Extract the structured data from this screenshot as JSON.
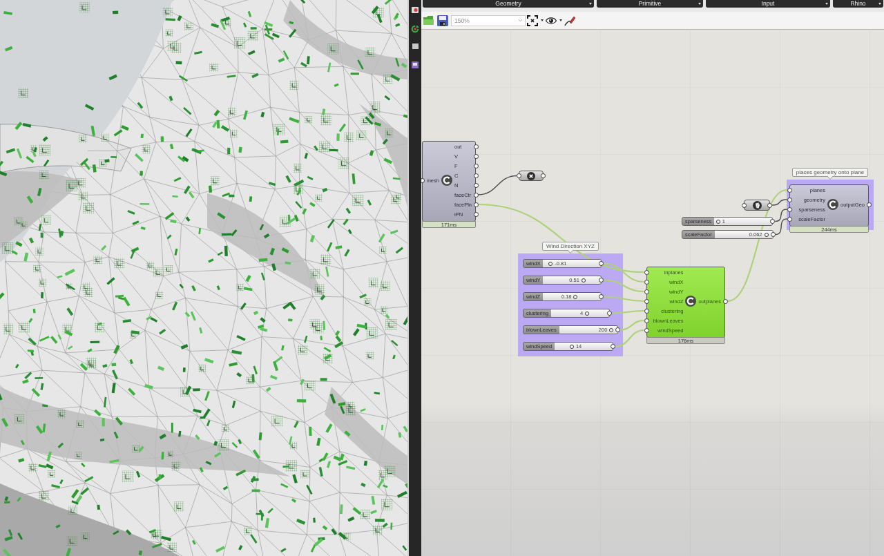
{
  "ribbon": {
    "tabs": [
      {
        "label": "Geometry"
      },
      {
        "label": "Primitive"
      },
      {
        "label": "Input"
      },
      {
        "label": "Rhino"
      }
    ]
  },
  "toolbar": {
    "zoom": "150%"
  },
  "canvas": {
    "components": [
      {
        "inputs": [
          "mesh"
        ],
        "outputs": [
          "out",
          "V",
          "F",
          "C",
          "N",
          "faceCtr",
          "facePln",
          "iPN"
        ],
        "time": "171ms",
        "selected": false
      },
      {
        "inputs": [
          "inplanes",
          "windX",
          "windY",
          "windZ",
          "clustering",
          "blownLeaves",
          "windSpeed"
        ],
        "outputs": [
          "outplanes"
        ],
        "time": "176ms",
        "selected": true
      },
      {
        "inputs": [
          "planes",
          "geometry",
          "sparseness",
          "scaleFactor"
        ],
        "outputs": [
          "outputGeo"
        ],
        "time": "244ms",
        "selected": false
      }
    ],
    "groups": [
      {
        "title": "Wind Direction XYZ",
        "sliders": [
          {
            "name": "windX",
            "value": "-0.81",
            "level": 0.1
          },
          {
            "name": "windY",
            "value": "0.51",
            "level": 0.71
          },
          {
            "name": "windZ",
            "value": "0.18",
            "level": 0.57
          },
          {
            "name": "clustering",
            "value": "4",
            "level": 0.63
          },
          {
            "name": "blownLeaves",
            "value": "200",
            "level": 0.93
          },
          {
            "name": "windSpeed",
            "value": "14",
            "level": 0.28
          }
        ]
      },
      {
        "title": "places geometry onto plane"
      }
    ],
    "sliders": [
      {
        "name": "sparseness",
        "value": "1",
        "level": 0.03
      },
      {
        "name": "scaleFactor",
        "value": "0.062",
        "level": 0.92
      }
    ]
  }
}
